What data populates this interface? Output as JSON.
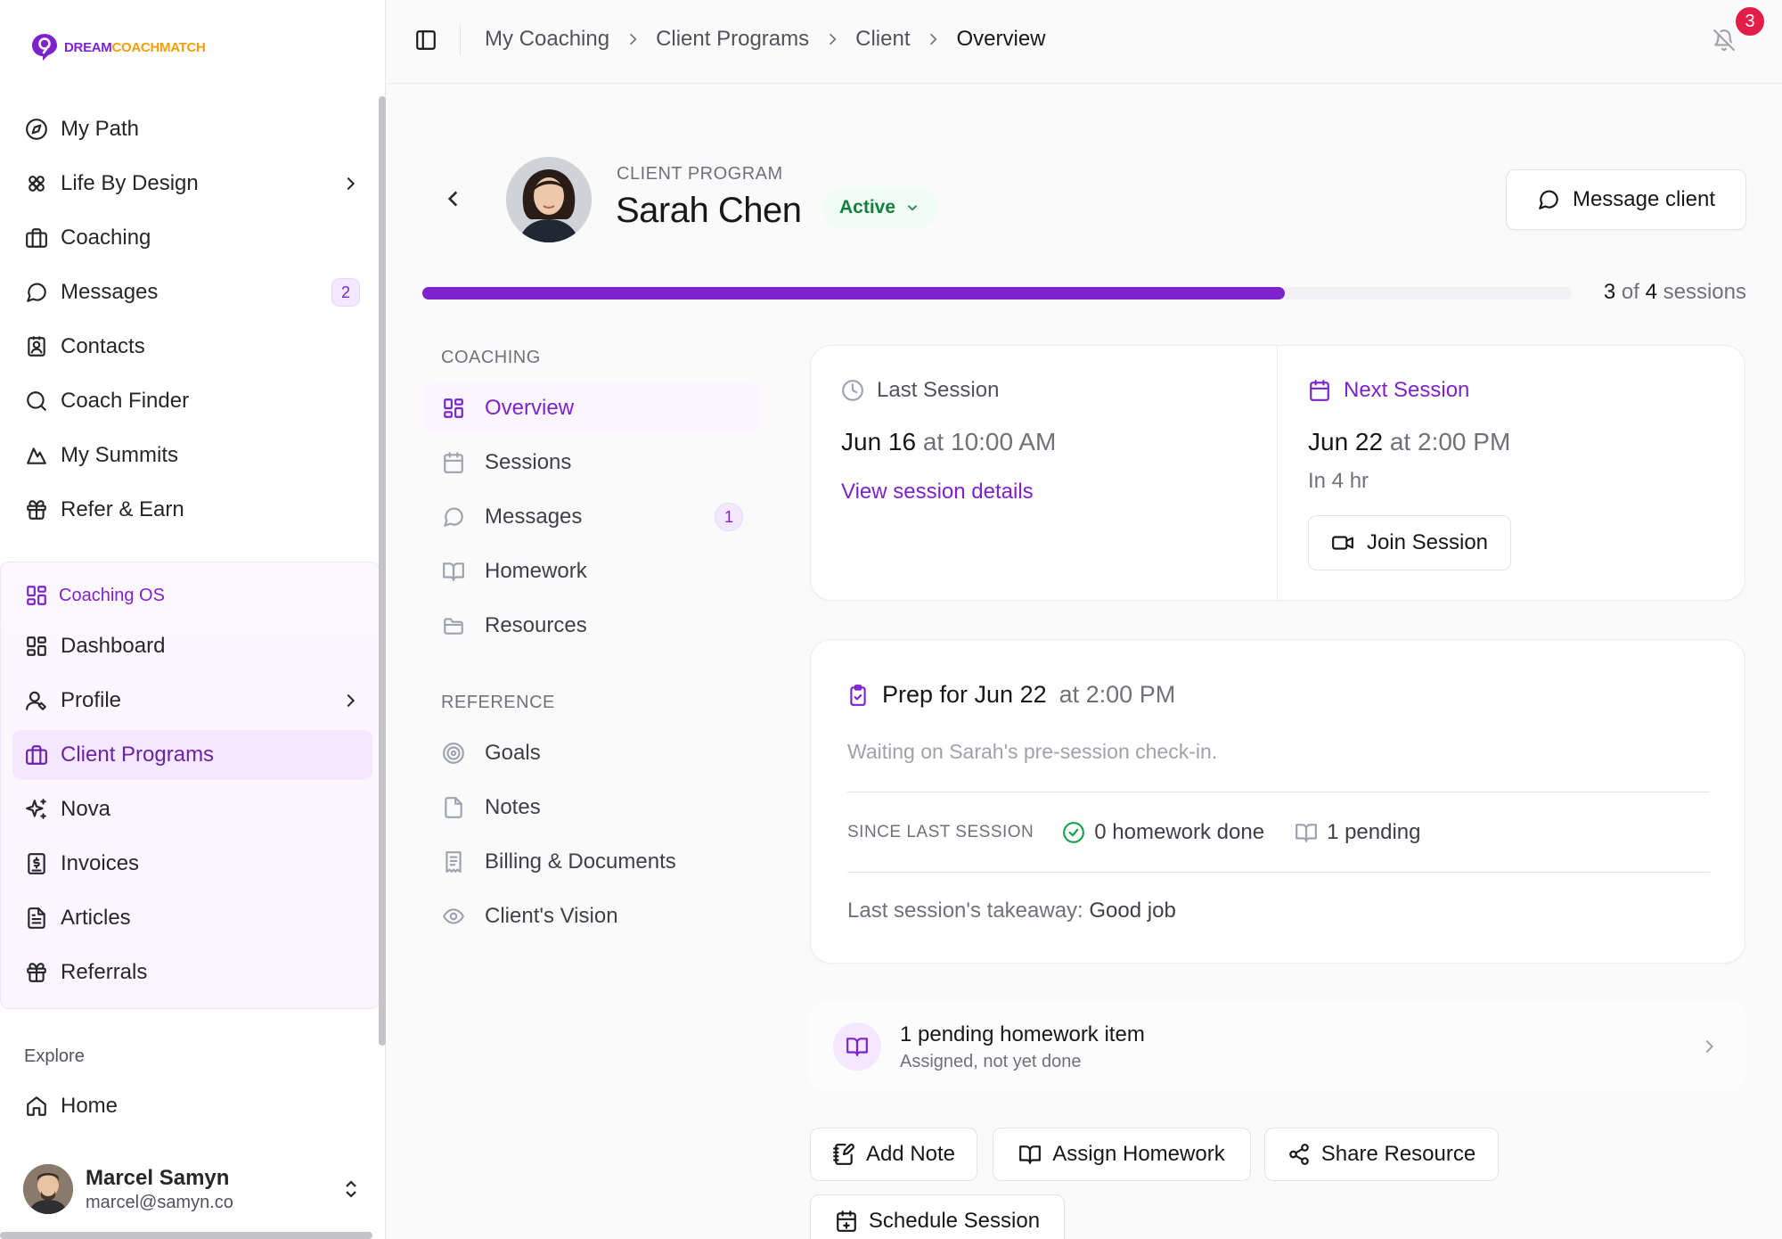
{
  "brand": {
    "logo_part1": "DREAM",
    "logo_part2": "COACHMATCH",
    "accent": "#7e22ce"
  },
  "sidebar": {
    "items": [
      {
        "label": "My Path",
        "icon": "compass-icon"
      },
      {
        "label": "Life By Design",
        "icon": "flower-icon",
        "has_submenu": true
      },
      {
        "label": "Coaching",
        "icon": "briefcase-icon"
      },
      {
        "label": "Messages",
        "icon": "message-icon",
        "badge": "2"
      },
      {
        "label": "Contacts",
        "icon": "contact-icon"
      },
      {
        "label": "Coach Finder",
        "icon": "search-icon"
      },
      {
        "label": "My Summits",
        "icon": "mountain-icon"
      },
      {
        "label": "Refer & Earn",
        "icon": "gift-icon"
      }
    ],
    "os_section": {
      "title": "Coaching OS",
      "items": [
        {
          "label": "Dashboard",
          "icon": "dashboard-icon"
        },
        {
          "label": "Profile",
          "icon": "user-icon",
          "has_submenu": true
        },
        {
          "label": "Client Programs",
          "icon": "briefcase-icon",
          "active": true
        },
        {
          "label": "Nova",
          "icon": "sparkles-icon"
        },
        {
          "label": "Invoices",
          "icon": "invoice-icon"
        },
        {
          "label": "Articles",
          "icon": "file-text-icon"
        },
        {
          "label": "Referrals",
          "icon": "gift-icon"
        }
      ]
    },
    "explore": {
      "heading": "Explore",
      "items": [
        {
          "label": "Home",
          "icon": "home-icon"
        }
      ]
    },
    "user": {
      "name": "Marcel Samyn",
      "email": "marcel@samyn.co"
    }
  },
  "topbar": {
    "breadcrumbs": [
      "My Coaching",
      "Client Programs",
      "Client",
      "Overview"
    ],
    "notifications": "3"
  },
  "client": {
    "program_label": "CLIENT PROGRAM",
    "name": "Sarah Chen",
    "status": "Active",
    "message_button": "Message client"
  },
  "progress": {
    "completed": "3",
    "total": "4",
    "of_word": "of",
    "unit": "sessions",
    "fraction": 0.75
  },
  "subnav": {
    "coaching_heading": "COACHING",
    "coaching": [
      {
        "label": "Overview",
        "icon": "dashboard-icon",
        "active": true
      },
      {
        "label": "Sessions",
        "icon": "calendar-icon"
      },
      {
        "label": "Messages",
        "icon": "message-icon",
        "badge": "1"
      },
      {
        "label": "Homework",
        "icon": "book-icon"
      },
      {
        "label": "Resources",
        "icon": "folder-icon"
      }
    ],
    "reference_heading": "REFERENCE",
    "reference": [
      {
        "label": "Goals",
        "icon": "target-icon"
      },
      {
        "label": "Notes",
        "icon": "note-icon"
      },
      {
        "label": "Billing & Documents",
        "icon": "receipt-icon"
      },
      {
        "label": "Client's Vision",
        "icon": "eye-icon"
      }
    ]
  },
  "last_session": {
    "heading": "Last Session",
    "date": "Jun 16",
    "at": "at 10:00 AM",
    "link": "View session details"
  },
  "next_session": {
    "heading": "Next Session",
    "date": "Jun 22",
    "at": "at 2:00 PM",
    "relative": "In 4 hr",
    "join_button": "Join Session"
  },
  "prep": {
    "title_prefix": "Prep for Jun 22",
    "title_suffix": "at 2:00 PM",
    "waiting": "Waiting on Sarah's pre-session check-in.",
    "since_label": "SINCE LAST SESSION",
    "homework_done": "0 homework done",
    "pending": "1 pending",
    "takeaway_label": "Last session's takeaway:",
    "takeaway_value": "Good job"
  },
  "homework_row": {
    "title": "1 pending homework item",
    "subtitle": "Assigned, not yet done"
  },
  "actions": {
    "add_note": "Add Note",
    "assign_homework": "Assign Homework",
    "share_resource": "Share Resource",
    "schedule_session": "Schedule Session"
  }
}
